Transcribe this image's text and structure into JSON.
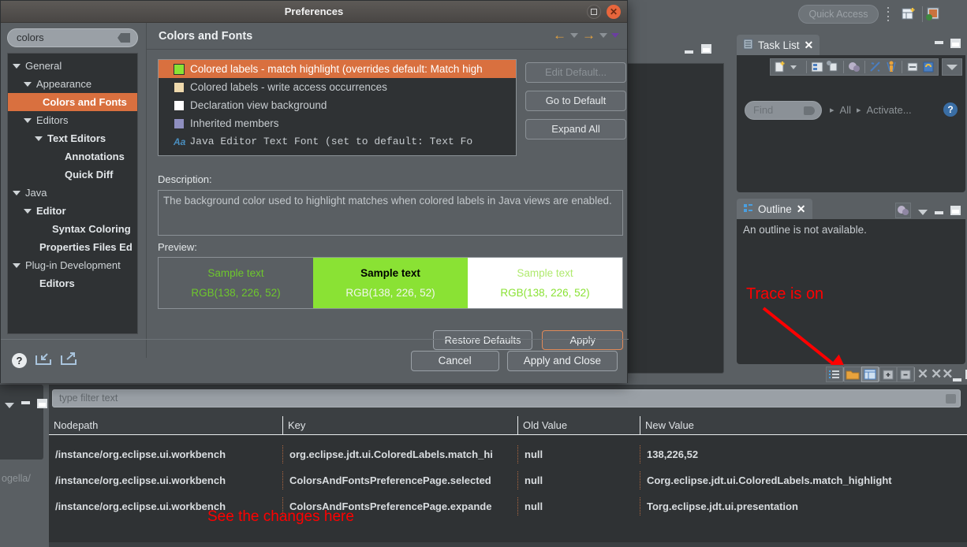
{
  "workbench": {
    "quick_access_placeholder": "Quick Access",
    "icons": {
      "open_perspective": "open-perspective-icon",
      "java_perspective": "java-perspective-icon"
    }
  },
  "task_list": {
    "title": "Task List",
    "close": "✕",
    "find_placeholder": "Find",
    "breadcrumb": [
      "All",
      "Activate..."
    ],
    "toolbar_icons": [
      "new-task-icon",
      "dropdown-icon",
      "categorized-presentation-icon",
      "scheduled-presentation-icon",
      "focus-on-workweek-icon",
      "filter-completed-icon",
      "my-tasks-icon",
      "collapse-all-icon",
      "synchronize-changed-icon",
      "view-menu-icon"
    ]
  },
  "outline": {
    "title": "Outline",
    "close": "✕",
    "message": "An outline is not available."
  },
  "annotations": {
    "trace_on": "Trace is on",
    "see_changes": "See the changes here",
    "color": "#ff0000"
  },
  "preference_spy": {
    "filter_placeholder": "type filter text",
    "columns": [
      "Nodepath",
      "Key",
      "Old Value",
      "New Value"
    ],
    "rows": [
      {
        "nodepath": "/instance/org.eclipse.ui.workbench",
        "key": "org.eclipse.jdt.ui.ColoredLabels.match_hi",
        "old_value": "null",
        "new_value": "138,226,52"
      },
      {
        "nodepath": "/instance/org.eclipse.ui.workbench",
        "key": "ColorsAndFontsPreferencePage.selected",
        "old_value": "null",
        "new_value": "Corg.eclipse.jdt.ui.ColoredLabels.match_highlight"
      },
      {
        "nodepath": "/instance/org.eclipse.ui.workbench",
        "key": "ColorsAndFontsPreferencePage.expande",
        "old_value": "null",
        "new_value": "Torg.eclipse.jdt.ui.presentation"
      }
    ],
    "toolbar_icons": [
      "list-view-icon",
      "open-folder-icon",
      "table-view-icon",
      "expand-all-icon",
      "collapse-all-icon",
      "remove-icon",
      "remove-all-icon"
    ]
  },
  "status_text": "ogella/",
  "dialog": {
    "title": "Preferences",
    "restore_button": "restore-window-button",
    "close_button": "✕",
    "search": {
      "value": "colors",
      "clear_icon": "clear-search-icon"
    },
    "tree": [
      {
        "label": "General",
        "depth": 0,
        "expandable": true,
        "selected": false,
        "bold": false
      },
      {
        "label": "Appearance",
        "depth": 1,
        "expandable": true,
        "selected": false,
        "bold": false
      },
      {
        "label": "Colors and Fonts",
        "depth": 2,
        "expandable": false,
        "selected": true,
        "bold": true
      },
      {
        "label": "Editors",
        "depth": 1,
        "expandable": true,
        "selected": false,
        "bold": false
      },
      {
        "label": "Text Editors",
        "depth": 2,
        "expandable": true,
        "selected": false,
        "bold": true
      },
      {
        "label": "Annotations",
        "depth": 3,
        "expandable": false,
        "selected": false,
        "bold": true
      },
      {
        "label": "Quick Diff",
        "depth": 3,
        "expandable": false,
        "selected": false,
        "bold": true
      },
      {
        "label": "Java",
        "depth": 0,
        "expandable": true,
        "selected": false,
        "bold": false
      },
      {
        "label": "Editor",
        "depth": 1,
        "expandable": true,
        "selected": false,
        "bold": true
      },
      {
        "label": "Syntax Coloring",
        "depth": 2,
        "expandable": false,
        "selected": false,
        "bold": true
      },
      {
        "label": "Properties Files Ed",
        "depth": 1,
        "expandable": false,
        "selected": false,
        "bold": true
      },
      {
        "label": "Plug-in Development",
        "depth": 0,
        "expandable": true,
        "selected": false,
        "bold": false
      },
      {
        "label": "Editors",
        "depth": 1,
        "expandable": false,
        "selected": false,
        "bold": true
      }
    ],
    "page_title": "Colors and Fonts",
    "nav": {
      "back": "←",
      "forward": "→"
    },
    "color_list": [
      {
        "label": "Colored labels - match highlight (overrides default: Match high",
        "swatch": "#8ae234",
        "selected": true,
        "font": false
      },
      {
        "label": "Colored labels - write access occurrences",
        "swatch": "#eed9ac",
        "selected": false,
        "font": false
      },
      {
        "label": "Declaration view background",
        "swatch": "#ffffff",
        "selected": false,
        "font": false
      },
      {
        "label": "Inherited members",
        "swatch": "#8f8fc0",
        "selected": false,
        "font": false
      },
      {
        "label": "Java Editor Text Font (set to default: Text Fo",
        "swatch": "",
        "selected": false,
        "font": true
      }
    ],
    "side_buttons": [
      {
        "label": "Edit Default...",
        "disabled": true
      },
      {
        "label": "Go to Default",
        "disabled": false
      },
      {
        "label": "Expand All",
        "disabled": false
      }
    ],
    "description_label": "Description:",
    "description_text": "The background color used to highlight matches when colored labels in Java views are enabled.",
    "preview_label": "Preview:",
    "preview_cells": [
      {
        "sample": "Sample text",
        "rgb": "RGB(138, 226, 52)"
      },
      {
        "sample": "Sample text",
        "rgb": "RGB(138, 226, 52)"
      },
      {
        "sample": "Sample text",
        "rgb": "RGB(138, 226, 52)"
      }
    ],
    "restore_defaults": "Restore Defaults",
    "apply": "Apply",
    "cancel": "Cancel",
    "apply_and_close": "Apply and Close",
    "footer_icons": [
      "help-icon",
      "import-icon",
      "export-icon"
    ]
  },
  "colors": {
    "accent_orange": "#d9703f",
    "green": "#8ae234",
    "annotation_red": "#ff0000"
  }
}
